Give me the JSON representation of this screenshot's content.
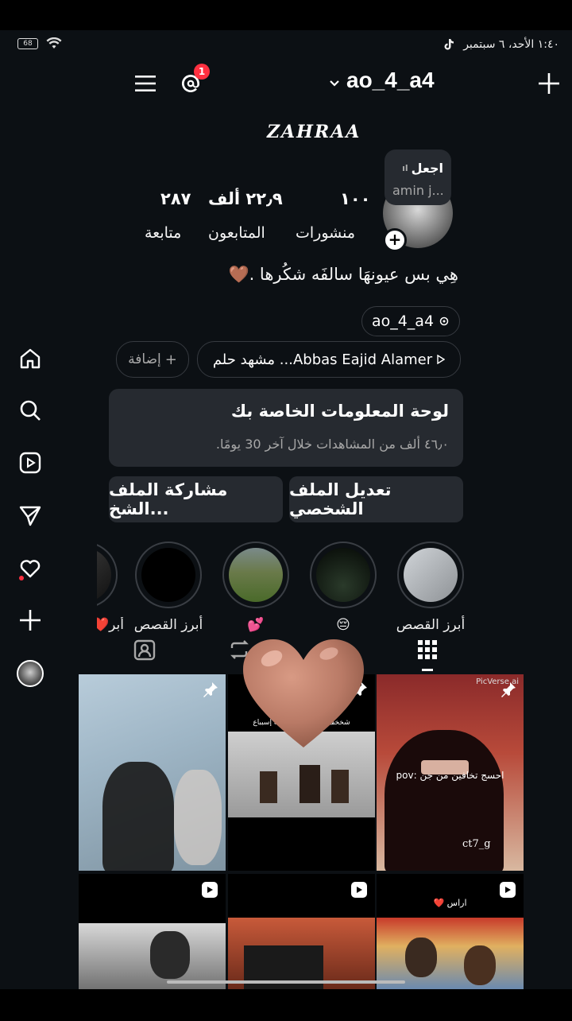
{
  "status": {
    "time": "١:٤٠ الأحد، ٦ سبتمبر",
    "battery": "68"
  },
  "header": {
    "username": "ao_4_a4",
    "notification_count": "1"
  },
  "profile": {
    "display_name": "ZAHRAA",
    "note": {
      "title": "اجعل",
      "subtitle": "amin j..."
    },
    "stats": [
      {
        "value": "١٠٠",
        "label": "منشورات"
      },
      {
        "value": "٢٢٫٩ ألف",
        "label": "المتابعون"
      },
      {
        "value": "٢٨٧",
        "label": "متابعة"
      }
    ],
    "bio": "هِي بس عيونهَا سالفَه شكُرها .🤎",
    "threads_handle": "ao_4_a4",
    "music": "مشهد حلم ...Abbas Eajid Alamer",
    "add_label": "إضافة"
  },
  "dashboard": {
    "title": "لوحة المعلومات الخاصة بك",
    "subtitle": "٤٦٫٠ ألف من المشاهدات خلال آخر 30 يومًا."
  },
  "buttons": {
    "edit": "تعديل الملف الشخصي",
    "share": "مشاركة الملف الشخ..."
  },
  "highlights": [
    {
      "label": "أبرز القصص"
    },
    {
      "label": "😔"
    },
    {
      "label": "💕"
    },
    {
      "label": "أبرز القصص"
    },
    {
      "label": "أبر❤️"
    }
  ],
  "grid": [
    {
      "caption": ""
    },
    {
      "caption": "شخخف غني من زلم كلهة إسبباع"
    },
    {
      "caption": "احسج تخافين من جن :pov",
      "watermark": "PicVerse.ai",
      "tag": "ct7_g"
    },
    {
      "caption": ""
    },
    {
      "caption": ""
    },
    {
      "caption": "اراس ❤️"
    }
  ],
  "colors": {
    "background": "#0c1014",
    "card": "#262a30",
    "badge": "#ff3040",
    "heart": "#c1836e"
  }
}
